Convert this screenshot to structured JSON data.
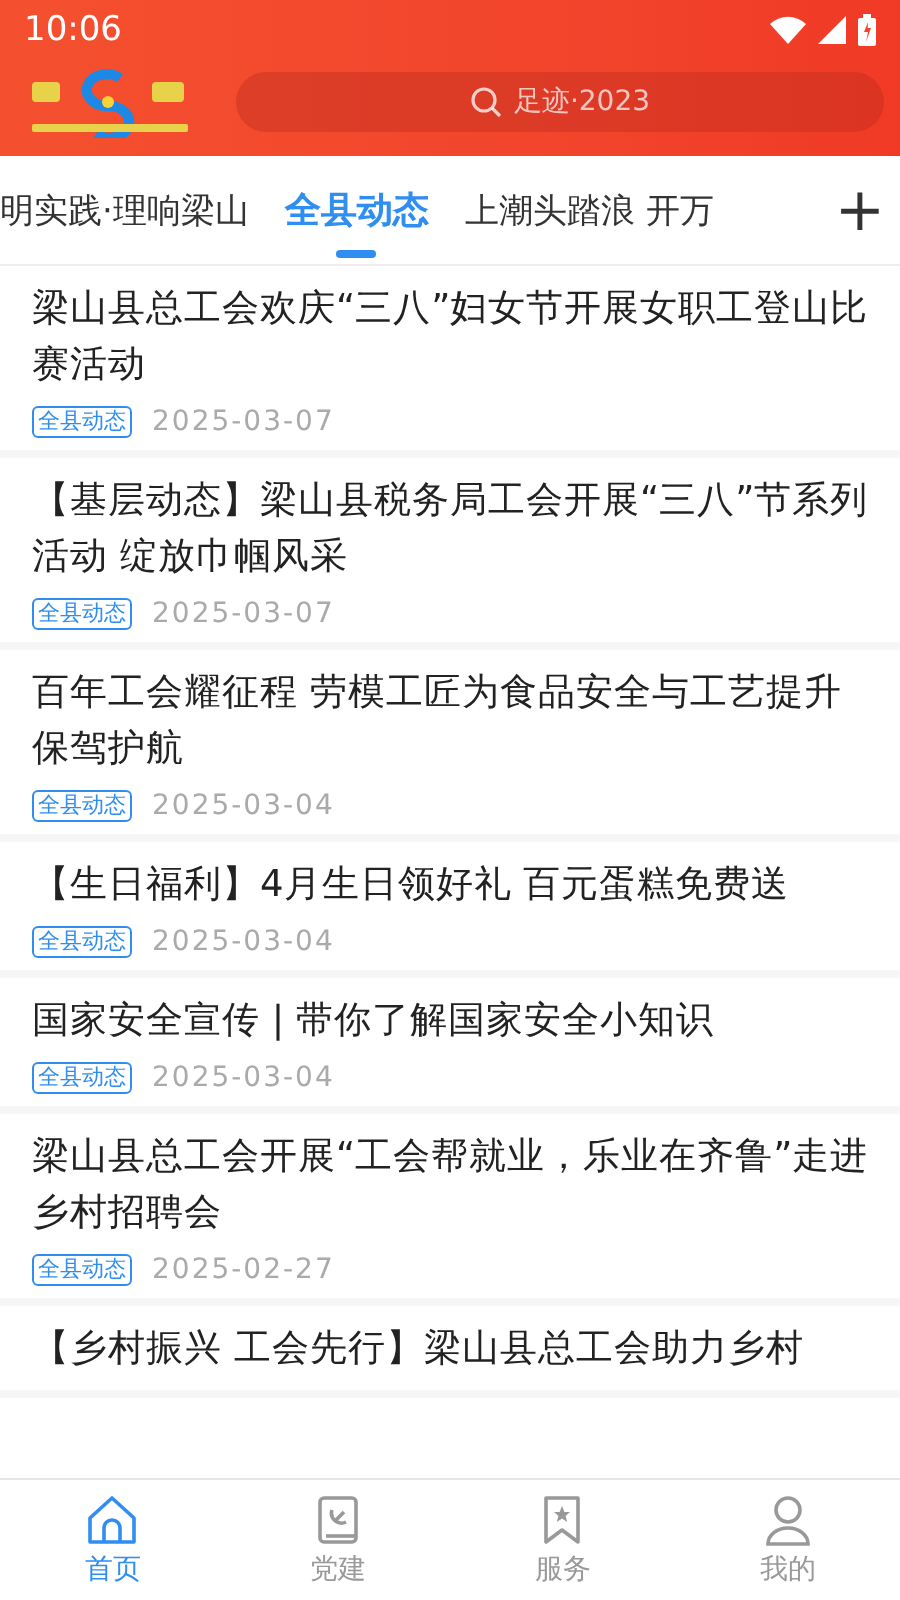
{
  "status_bar": {
    "time": "10:06"
  },
  "header": {
    "search": {
      "placeholder": "足迹·2023"
    }
  },
  "tabs": [
    {
      "label": "明实践·理响梁山",
      "selected": false
    },
    {
      "label": "全县动态",
      "selected": true
    },
    {
      "label": "上潮头踏浪 开万",
      "selected": false
    }
  ],
  "add_tab": "+",
  "articles": [
    {
      "title": "梁山县总工会欢庆“三八”妇女节开展女职工登山比赛活动",
      "tag": "全县动态",
      "date": "2025-03-07"
    },
    {
      "title": "【基层动态】梁山县税务局工会开展“三八”节系列活动  绽放巾帼风采",
      "tag": "全县动态",
      "date": "2025-03-07"
    },
    {
      "title": "百年工会耀征程  劳模工匠为食品安全与工艺提升保驾护航",
      "tag": "全县动态",
      "date": "2025-03-04"
    },
    {
      "title": "【生日福利】4月生日领好礼  百元蛋糕免费送",
      "tag": "全县动态",
      "date": "2025-03-04"
    },
    {
      "title": "国家安全宣传   |   带你了解国家安全小知识",
      "tag": "全县动态",
      "date": "2025-03-04"
    },
    {
      "title": "梁山县总工会开展“工会帮就业，乐业在齐鲁”走进乡村招聘会",
      "tag": "全县动态",
      "date": "2025-02-27"
    },
    {
      "title": "【乡村振兴  工会先行】梁山县总工会助力乡村"
    }
  ],
  "nav": [
    {
      "kind": "home",
      "label": "首页",
      "selected": true
    },
    {
      "kind": "party",
      "label": "党建",
      "selected": false
    },
    {
      "kind": "service",
      "label": "服务",
      "selected": false
    },
    {
      "kind": "profile",
      "label": "我的",
      "selected": false
    }
  ]
}
